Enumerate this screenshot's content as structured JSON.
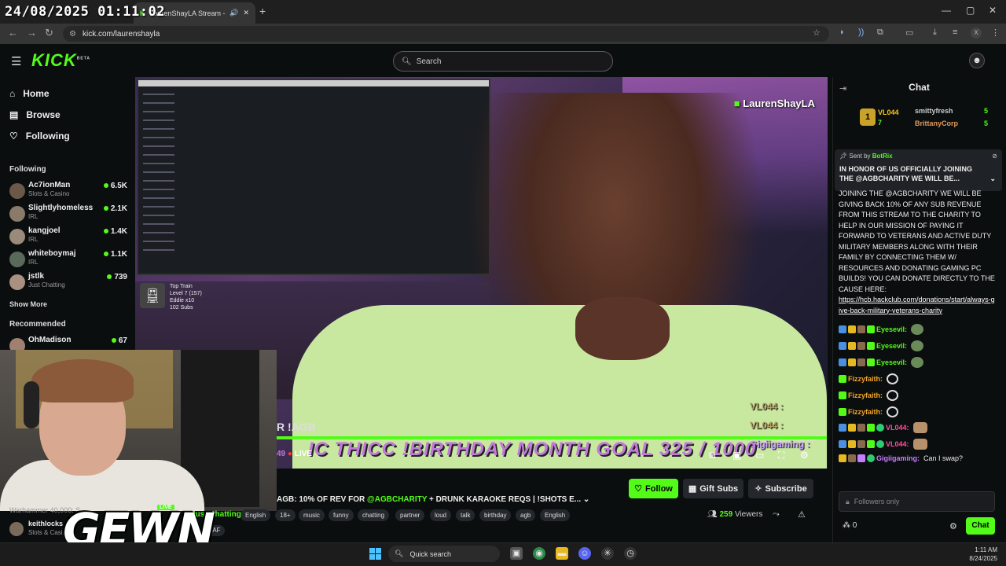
{
  "overlay_clock": "24/08/2025 01:11:02",
  "browser": {
    "tab_title": "LaurenShayLA Stream - Wa",
    "url": "kick.com/laurenshayla",
    "profile_initial": "X"
  },
  "kick": {
    "logo": "KICK",
    "logo_beta": "BETA",
    "search_placeholder": "Search"
  },
  "sidebar": {
    "nav": [
      {
        "label": "Home",
        "icon": "home-icon"
      },
      {
        "label": "Browse",
        "icon": "browse-icon"
      },
      {
        "label": "Following",
        "icon": "heart-icon"
      }
    ],
    "following_header": "Following",
    "following": [
      {
        "name": "Ac7ionMan",
        "category": "Slots & Casino",
        "viewers": "6.5K"
      },
      {
        "name": "Slightlyhomeless",
        "category": "IRL",
        "viewers": "2.1K"
      },
      {
        "name": "kangjoel",
        "category": "IRL",
        "viewers": "1.4K"
      },
      {
        "name": "whiteboymaj",
        "category": "IRL",
        "viewers": "1.1K"
      },
      {
        "name": "jstlk",
        "category": "Just Chatting",
        "viewers": "739"
      }
    ],
    "show_more": "Show More",
    "recommended_header": "Recommended",
    "recommended": [
      {
        "name": "OhMadison",
        "category": "",
        "viewers": "67"
      }
    ],
    "bottom_partial": "Warhammer 40,000: S...",
    "bottom_channel": {
      "name": "keithlocks",
      "category": "Slots & Casin"
    }
  },
  "video": {
    "streamer_watermark": "LaurenShayLA",
    "train": {
      "title": "Top Train",
      "level": "Level 7 (157)",
      "user": "Eddie x10",
      "subs": "102 Subs"
    },
    "overlay_chat": [
      {
        "name": "VL044 :"
      },
      {
        "name": "VL044 :"
      },
      {
        "name": "Gigiigaming :"
      }
    ],
    "can_i_swap": "Can I swap?",
    "scroll_text": "R !AGB",
    "goal_text": "IC THICC !BIRTHDAY MONTH GOAL  325 / 1000",
    "goal_prefix": "49",
    "live_label": "LIVE"
  },
  "stream_info": {
    "title_prefix": "AGB:  10% OF REV FOR ",
    "title_mention": "@AGBCHARITY",
    "title_suffix": "  + DRUNK KARAOKE REQS  | !SHOTS E...",
    "category": "Just Chatting",
    "tags": [
      "English",
      "18+",
      "music",
      "funny",
      "chatting",
      "partner",
      "loud",
      "talk",
      "birthday",
      "agb",
      "English"
    ],
    "extra_tag": "SAF",
    "follow_label": "Follow",
    "gift_label": "Gift Subs",
    "subscribe_label": "Subscribe",
    "viewers_count": "259",
    "viewers_label": "Viewers",
    "live_badge": "LIVE"
  },
  "webcam_brand": "GEWN",
  "chat": {
    "header": "Chat",
    "leaderboard": [
      {
        "name": "VL044",
        "count": "7",
        "color": "#f5c518"
      },
      {
        "name": "smittyfresh",
        "count": "5",
        "color": "#cccccc"
      },
      {
        "name": "BrittanyCorp",
        "count": "5",
        "color": "#e39a5a"
      }
    ],
    "pinned": {
      "sent_by_label": "Sent by",
      "sender": "BotRix",
      "text": "IN HONOR OF US OFFICIALLY JOINING THE @AGBCHARITY WE WILL BE..."
    },
    "message_body": "JOINING THE @AGBCHARITY WE WILL BE GIVING BACK 10% OF ANY SUB REVENUE FROM THIS STREAM TO THE CHARITY TO HELP IN OUR MISSION OF PAYING IT FORWARD TO VETERANS AND ACTIVE DUTY MILITARY MEMBERS ALONG WITH THEIR FAMILY BY CONNECTING THEM W/ RESOURCES AND DONATING GAMING PC BUILDS! YOU CAN DONATE DIRECTLY TO THE CAUSE HERE:",
    "message_link": "https://hcb.hackclub.com/donations/start/always-give-back-military-veterans-charity",
    "messages": [
      {
        "user": "Eyesevil:",
        "color": "#53fc18",
        "emote": "emote"
      },
      {
        "user": "Eyesevil:",
        "color": "#53fc18",
        "emote": "emote"
      },
      {
        "user": "Eyesevil:",
        "color": "#53fc18",
        "emote": "emote"
      },
      {
        "user": "Fizzyfaith:",
        "color": "#f5a623",
        "emote": "heart"
      },
      {
        "user": "Fizzyfaith:",
        "color": "#f5a623",
        "emote": "heart"
      },
      {
        "user": "Fizzyfaith:",
        "color": "#f5a623",
        "emote": "heart"
      },
      {
        "user": "VL044:",
        "color": "#ff4fa0",
        "emote": "fist"
      },
      {
        "user": "VL044:",
        "color": "#ff4fa0",
        "emote": "fist"
      },
      {
        "user": "Gigiigaming:",
        "color": "#c77dff",
        "emote": "text",
        "text": "Can I swap?"
      }
    ],
    "input_placeholder": "Followers only",
    "points": "0",
    "send_label": "Chat"
  },
  "taskbar": {
    "search_label": "Quick search",
    "time": "1:11 AM",
    "date": "8/24/2025"
  }
}
